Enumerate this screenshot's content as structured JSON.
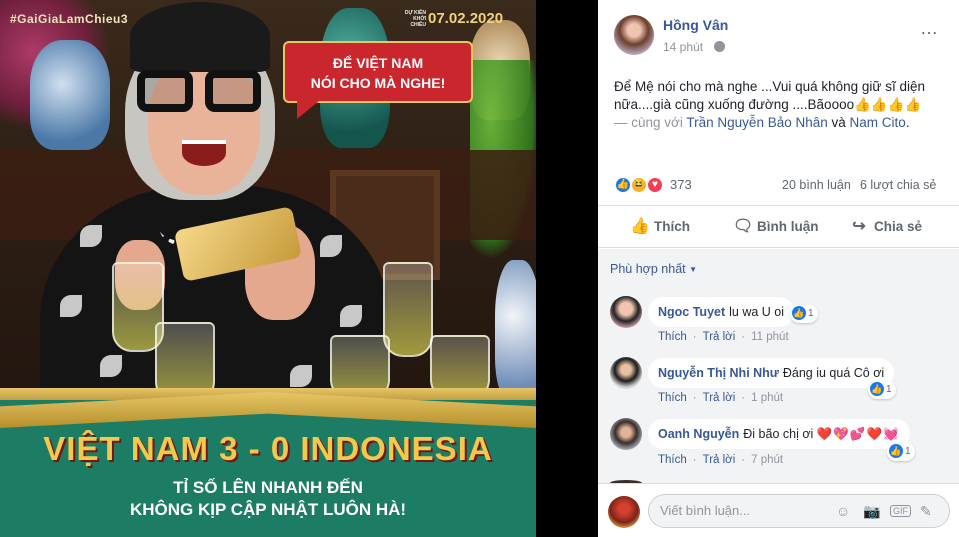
{
  "poster": {
    "hashtag": "#GaiGiaLamChieu3",
    "release_small": "DỰ KIẾN KHỞI CHIẾU",
    "release_date": "07.02.2020",
    "bubble_line1": "ĐỂ VIỆT NAM",
    "bubble_line2": "NÓI CHO MÀ NGHE!",
    "score": "VIỆT NAM 3 - 0 INDONESIA",
    "sub_line1": "TỈ SỐ LÊN NHANH ĐẾN",
    "sub_line2": "KHÔNG KỊP CẬP NHẬT LUÔN HÀ!"
  },
  "post": {
    "author": "Hồng Vân",
    "time": "14 phút",
    "more_icon": "…",
    "text_main": "Để Mệ nói cho mà nghe ...Vui quá không giữ sĩ diện nữa....già cũng xuống đường ....Bãoooo",
    "text_emoji": "👍👍👍👍",
    "with_prefix": "— cùng với",
    "tag1": "Trần Nguyễn Bảo Nhân",
    "and_word": "và",
    "tag2": "Nam Cito",
    "tag_end": "."
  },
  "stats": {
    "reactions": "373",
    "comments": "20 bình luận",
    "shares": "6 lượt chia sẻ"
  },
  "actions": {
    "like": "Thích",
    "comment": "Bình luận",
    "share": "Chia sẻ"
  },
  "sort_label": "Phù hợp nhất",
  "comments": [
    {
      "name": "Ngoc Tuyet",
      "text": "lu wa U oi",
      "reacts": "1",
      "like": "Thích",
      "reply": "Trả lời",
      "time": "11 phút"
    },
    {
      "name": "Nguyễn Thị Nhi Như",
      "text": "Đáng iu quá Cô ơi",
      "reacts": "1",
      "like": "Thích",
      "reply": "Trả lời",
      "time": "1 phút"
    },
    {
      "name": "Oanh Nguyễn",
      "text": "Đi bão chị ơi",
      "hearts": "❤️💖💕❤️💓",
      "reacts": "1",
      "like": "Thích",
      "reply": "Trả lời",
      "time": "7 phút"
    }
  ],
  "composer": {
    "placeholder": "Viết bình luận...",
    "gif_label": "GIF"
  },
  "colors": {
    "link": "#385898",
    "like_blue": "#1877f2",
    "banner_green": "#1c7d64",
    "bubble_red": "#c9262d"
  }
}
